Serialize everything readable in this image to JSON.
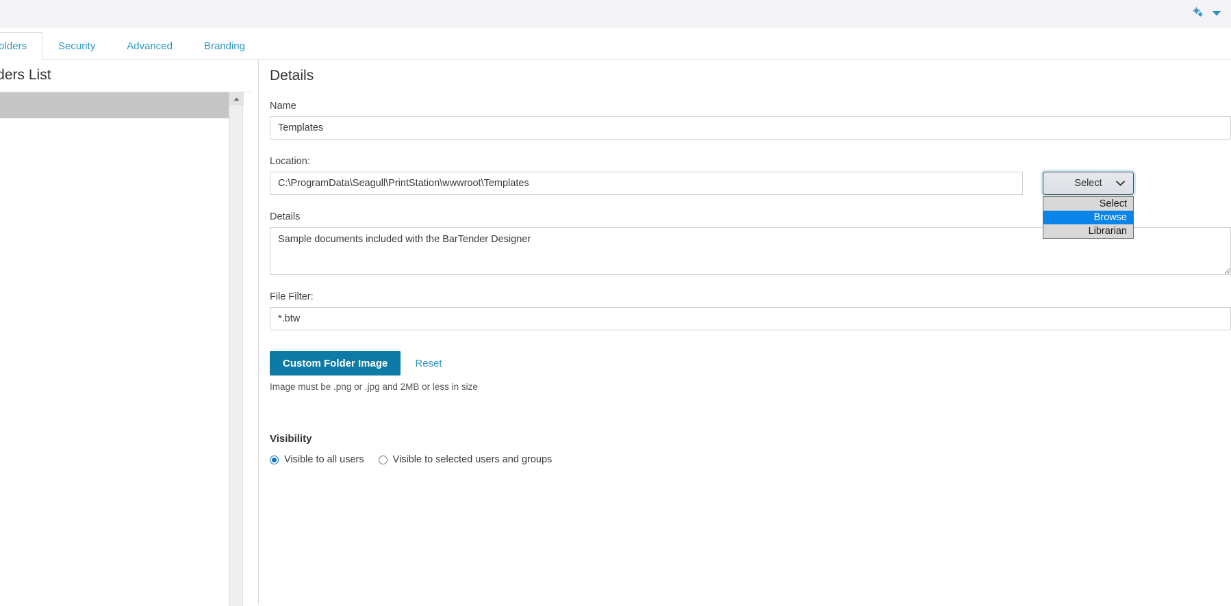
{
  "topbar": {
    "settings_icon": "gears-icon",
    "caret_icon": "chevron-down-icon"
  },
  "tabs": [
    {
      "label": "Folders",
      "active": true
    },
    {
      "label": "Security",
      "active": false
    },
    {
      "label": "Advanced",
      "active": false
    },
    {
      "label": "Branding",
      "active": false
    }
  ],
  "sidebar": {
    "title": "Folders List",
    "scroll_up_icon": "caret-up-icon"
  },
  "details": {
    "heading": "Details",
    "name_label": "Name",
    "name_value": "Templates",
    "location_label": "Location:",
    "location_value": "C:\\ProgramData\\Seagull\\PrintStation\\wwwroot\\Templates",
    "details_label": "Details",
    "details_value": "Sample documents included with the BarTender Designer",
    "file_filter_label": "File Filter:",
    "file_filter_value": "*.btw",
    "custom_folder_image_button": "Custom Folder Image",
    "reset_link": "Reset",
    "helper_text": "Image must be .png or .jpg and 2MB or less in size"
  },
  "location_select": {
    "value": "Select",
    "caret_icon": "chevron-down-icon",
    "open": true,
    "options": [
      {
        "label": "Select",
        "selected": false
      },
      {
        "label": "Browse",
        "selected": true
      },
      {
        "label": "Librarian",
        "selected": false
      }
    ]
  },
  "visibility": {
    "title": "Visibility",
    "options": [
      {
        "label": "Visible to all users",
        "selected": true
      },
      {
        "label": "Visible to selected users and groups",
        "selected": false
      }
    ]
  },
  "colors": {
    "accent": "#0e7ba6",
    "link": "#2b97c4",
    "highlight": "#0a84e8",
    "header_bg": "#f4f4f6"
  }
}
